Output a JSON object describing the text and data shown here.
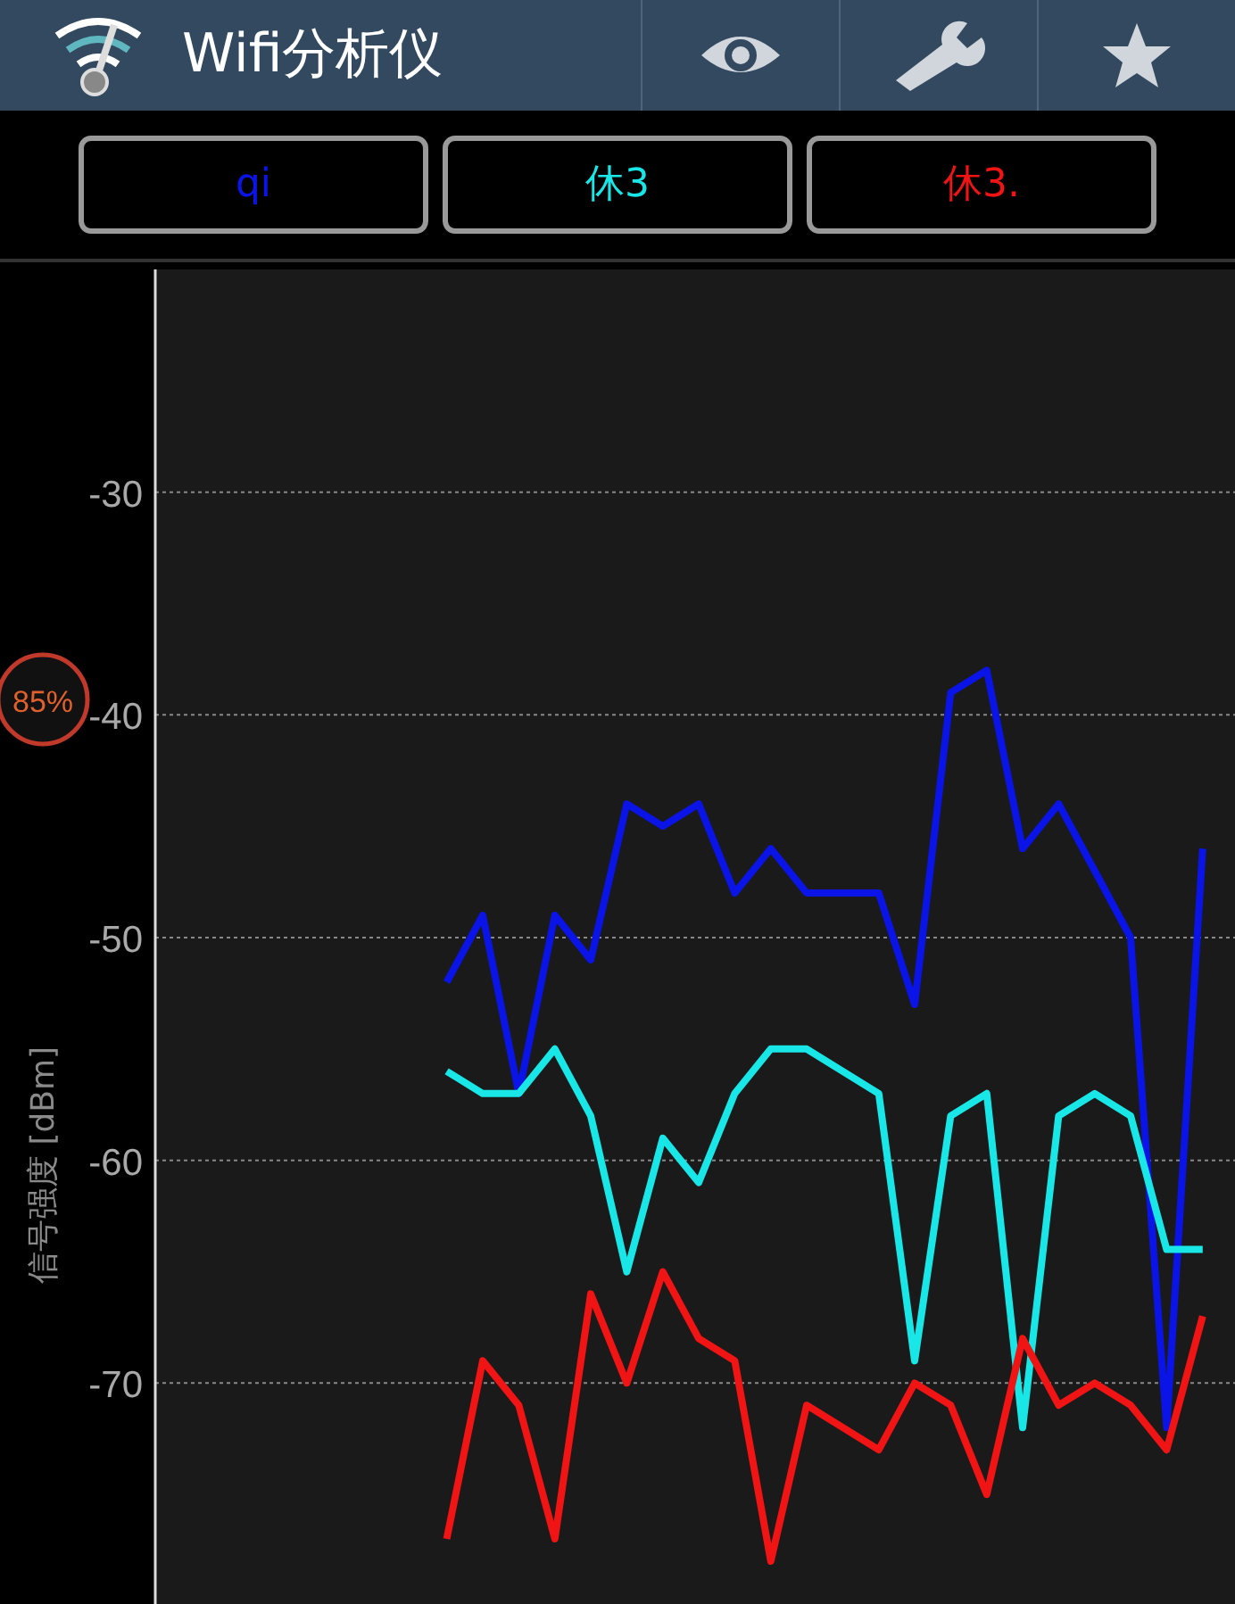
{
  "app_bar": {
    "title": "Wifi分析仪"
  },
  "signal_chart": {
    "zoom_badge": "85%",
    "chart_data": {
      "type": "line",
      "ylabel": "信号强度 [dBm]",
      "categories": [
        null,
        null,
        null,
        null,
        null,
        null,
        null,
        null,
        null,
        null,
        null,
        null,
        null,
        null,
        null,
        null,
        null,
        null,
        null,
        null,
        null,
        null,
        null,
        null,
        null,
        null,
        null,
        null,
        null,
        null
      ],
      "ylim": [
        -80,
        -20
      ],
      "grid": true,
      "yticks": [
        {
          "value": -30,
          "label": "-30"
        },
        {
          "value": -40,
          "label": "-40"
        },
        {
          "value": -50,
          "label": "-50"
        },
        {
          "value": -60,
          "label": "-60"
        },
        {
          "value": -70,
          "label": "-70"
        }
      ],
      "series": [
        {
          "name": "qi",
          "color": "#0a14e6",
          "values": [
            null,
            null,
            null,
            null,
            null,
            null,
            null,
            null,
            -52,
            -49,
            -57,
            -49,
            -51,
            -44,
            -45,
            -44,
            -48,
            -46,
            -48,
            -48,
            -48,
            -53,
            -39,
            -38,
            -46,
            -44,
            -47,
            -50,
            -72,
            -46
          ]
        },
        {
          "name": "休3",
          "color": "#19e6e6",
          "values": [
            null,
            null,
            null,
            null,
            null,
            null,
            null,
            null,
            -56,
            -57,
            -57,
            -55,
            -58,
            -65,
            -59,
            -61,
            -57,
            -55,
            -55,
            -56,
            -57,
            -69,
            -58,
            -57,
            -72,
            -58,
            -57,
            -58,
            -64,
            -64
          ]
        },
        {
          "name": "休3.",
          "color": "#f01414",
          "values": [
            null,
            null,
            null,
            null,
            null,
            null,
            null,
            null,
            -77,
            -69,
            -71,
            -77,
            -66,
            -70,
            -65,
            -68,
            -69,
            -78,
            -71,
            -72,
            -73,
            -70,
            -71,
            -75,
            -68,
            -71,
            -70,
            -71,
            -73,
            -67
          ]
        }
      ]
    }
  }
}
